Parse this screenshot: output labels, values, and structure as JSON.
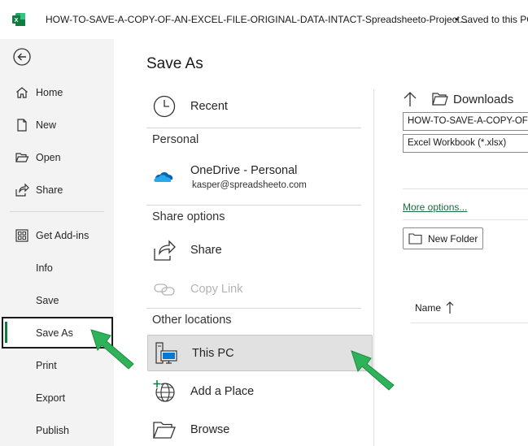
{
  "window": {
    "title": "HOW-TO-SAVE-A-COPY-OF-AN-EXCEL-FILE-ORIGINAL-DATA-INTACT-Spreadsheeto-Project...",
    "save_status": "• Saved to this PC"
  },
  "sidebar": {
    "back_icon": "back-arrow-icon",
    "items": [
      {
        "label": "Home",
        "icon": "home-icon"
      },
      {
        "label": "New",
        "icon": "new-document-icon"
      },
      {
        "label": "Open",
        "icon": "open-folder-icon"
      },
      {
        "label": "Share",
        "icon": "share-icon"
      },
      {
        "label": "Get Add-ins",
        "icon": "add-ins-icon"
      },
      {
        "label": "Info"
      },
      {
        "label": "Save"
      },
      {
        "label": "Save As",
        "active": true
      },
      {
        "label": "Print"
      },
      {
        "label": "Export"
      },
      {
        "label": "Publish"
      }
    ]
  },
  "main": {
    "title": "Save As",
    "locations": {
      "recent": "Recent",
      "personal_header": "Personal",
      "onedrive": {
        "label": "OneDrive - Personal",
        "email": "kasper@spreadsheeto.com"
      },
      "share_header": "Share options",
      "share": "Share",
      "copy_link": "Copy Link",
      "other_header": "Other locations",
      "this_pc": "This PC",
      "add_place": "Add a Place",
      "browse": "Browse"
    }
  },
  "right_pane": {
    "current_folder": "Downloads",
    "filename": "HOW-TO-SAVE-A-COPY-OF-AN-EXCEL-FILE",
    "file_type": "Excel Workbook (*.xlsx)",
    "more_options": "More options...",
    "new_folder": "New Folder",
    "column_name": "Name"
  },
  "colors": {
    "accent_green": "#107c41",
    "annotation_arrow": "#2fb35a"
  }
}
